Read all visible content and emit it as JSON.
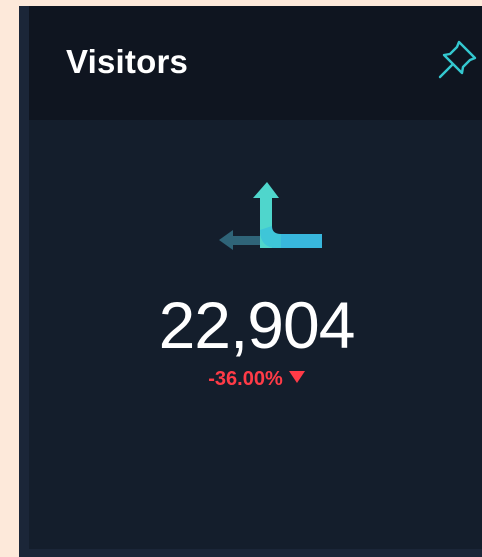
{
  "widget": {
    "title": "Visitors",
    "value": "22,904",
    "change": "-36.00%",
    "change_direction": "down",
    "colors": {
      "change_negative": "#ff3b47",
      "accent_teal": "#5fe0d0",
      "accent_blue": "#3ab8e0"
    },
    "icons": {
      "pin": "pin-icon",
      "kpi": "trend-split-arrow-icon"
    }
  }
}
